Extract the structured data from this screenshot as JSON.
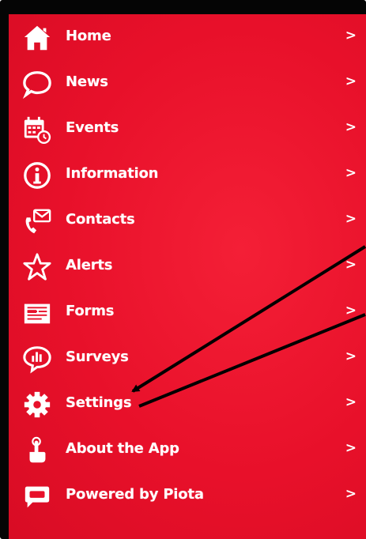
{
  "menu": {
    "items": [
      {
        "label": "Home",
        "icon": "home-icon"
      },
      {
        "label": "News",
        "icon": "speech-bubble-icon"
      },
      {
        "label": "Events",
        "icon": "calendar-clock-icon"
      },
      {
        "label": "Information",
        "icon": "info-icon"
      },
      {
        "label": "Contacts",
        "icon": "phone-mail-icon"
      },
      {
        "label": "Alerts",
        "icon": "star-icon"
      },
      {
        "label": "Forms",
        "icon": "form-icon"
      },
      {
        "label": "Surveys",
        "icon": "survey-chat-icon"
      },
      {
        "label": "Settings",
        "icon": "gear-icon"
      },
      {
        "label": "About the App",
        "icon": "tap-hand-icon"
      },
      {
        "label": "Powered by Piota",
        "icon": "chat-square-icon"
      }
    ],
    "chevron": ">"
  },
  "colors": {
    "background": "#e8102a",
    "frame": "#050505",
    "text": "#ffffff",
    "annotation_arrow": "#000000"
  }
}
